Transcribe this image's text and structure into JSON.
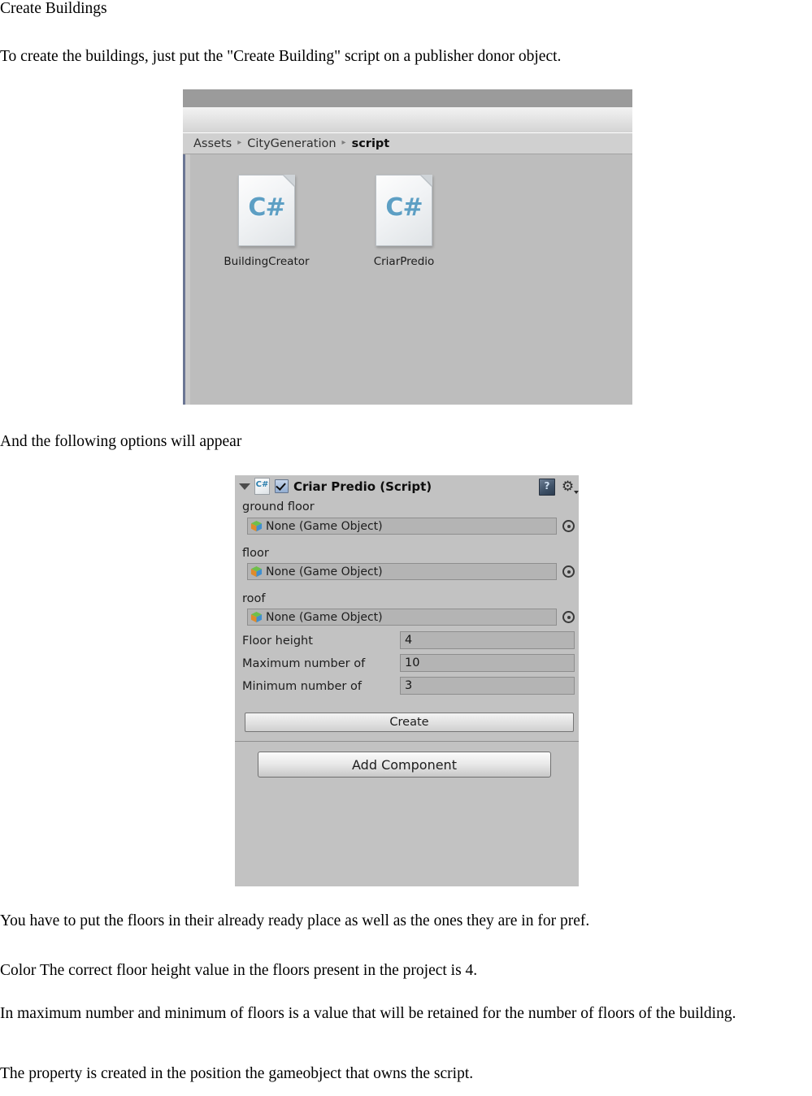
{
  "document": {
    "title": "Create Buildings",
    "intro": "To create the buildings, just put the \"Create Building\" script on a publisher donor object.",
    "options_caption": "And the following options will appear",
    "note_floors": "You have to put the floors in their already ready place as well as the ones they are in for pref.",
    "note_color": "Color The correct floor height value in the floors present in the project is 4.",
    "note_maxmin": "In maximum number and minimum of floors is a value that will be retained for the number of floors of the building.",
    "note_property": "The property is created in the position the gameobject that owns the script."
  },
  "project_window": {
    "breadcrumb": {
      "root": "Assets",
      "folder": "CityGeneration",
      "current": "script",
      "separator": "▸"
    },
    "assets": [
      {
        "name": "BuildingCreator",
        "icon": "csharp-script-icon",
        "icon_label": "C#"
      },
      {
        "name": "CriarPredio",
        "icon": "csharp-script-icon",
        "icon_label": "C#"
      }
    ]
  },
  "inspector": {
    "component_title": "Criar Predio (Script)",
    "enabled": true,
    "foldout_expanded": true,
    "help_icon": "help-book-icon",
    "gear_icon": "gear-icon",
    "gear_glyph": "⚙",
    "object_fields": [
      {
        "label": "ground floor",
        "value": "None (Game Object)",
        "icon": "gameobject-cube-icon"
      },
      {
        "label": "floor",
        "value": "None (Game Object)",
        "icon": "gameobject-cube-icon"
      },
      {
        "label": "roof",
        "value": "None (Game Object)",
        "icon": "gameobject-cube-icon"
      }
    ],
    "number_fields": [
      {
        "label": "Floor height",
        "value": "4"
      },
      {
        "label": "Maximum number of",
        "value": "10"
      },
      {
        "label": "Minimum number of",
        "value": "3"
      }
    ],
    "create_button": "Create",
    "add_component_button": "Add Component"
  },
  "colors": {
    "unity_panel_bg": "#c2c2c2",
    "project_bg": "#bdbdbd",
    "breadcrumb_bg": "#d0d0d0",
    "topbar": "#9b9b9b",
    "field_bg": "#b4b4b4",
    "checkbox_blue": "#93aed2",
    "csharp_blue": "#5d9fc4",
    "left_edge_blue": "#6b7694"
  }
}
